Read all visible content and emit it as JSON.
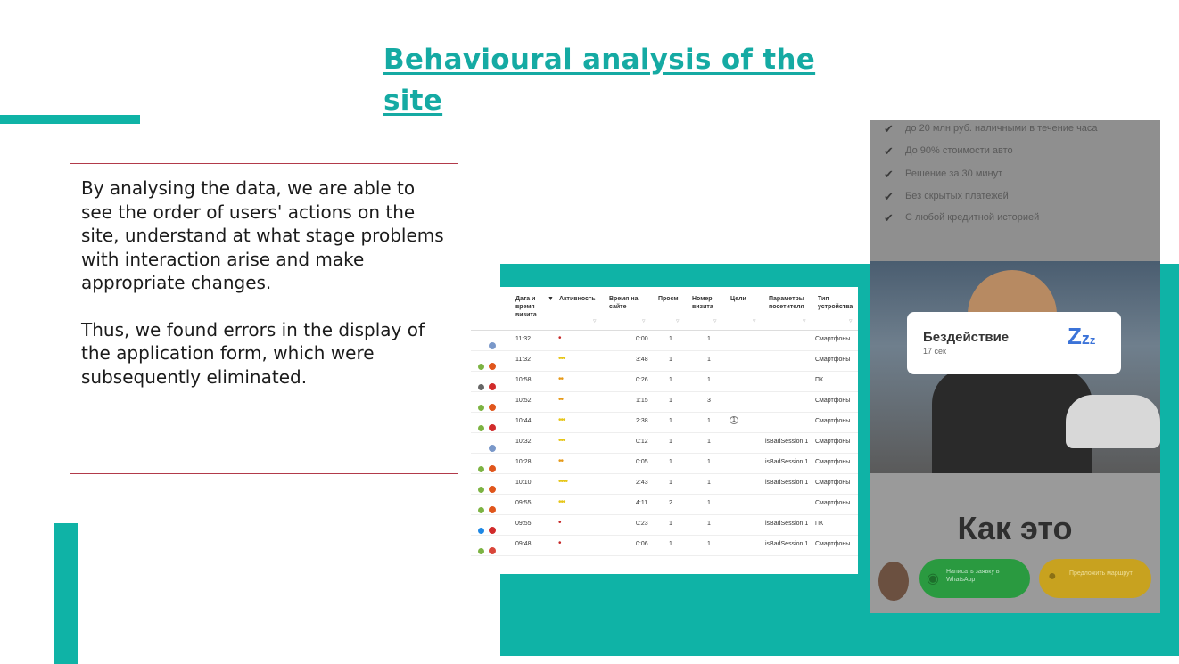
{
  "slide": {
    "title": "Behavioural analysis of the site",
    "paragraphs": [
      "By analysing the data, we are able to see the order of users' actions on the site, understand at what stage problems with interaction arise and make appropriate changes.",
      "Thus, we found errors in the display of the application form, which were subsequently eliminated."
    ],
    "accent_color": "#0fb3a6",
    "title_color": "#15aaa3",
    "box_border_color": "#b23a4a"
  },
  "visits_table": {
    "headers": [
      "Дата и время визита",
      "Активность",
      "Время на сайте",
      "Просм",
      "Номер визита",
      "Цели",
      "Параметры посетителя",
      "Тип устройства"
    ],
    "rows": [
      {
        "time": "11:32",
        "activity": "•",
        "duration": "0:00",
        "views": "1",
        "visit": "1",
        "goal": "",
        "params": "",
        "device": "Смартфоны"
      },
      {
        "time": "11:32",
        "activity": "•••",
        "duration": "3:48",
        "views": "1",
        "visit": "1",
        "goal": "",
        "params": "",
        "device": "Смартфоны"
      },
      {
        "time": "10:58",
        "activity": "••",
        "duration": "0:26",
        "views": "1",
        "visit": "1",
        "goal": "",
        "params": "",
        "device": "ПК"
      },
      {
        "time": "10:52",
        "activity": "••",
        "duration": "1:15",
        "views": "1",
        "visit": "3",
        "goal": "",
        "params": "",
        "device": "Смартфоны"
      },
      {
        "time": "10:44",
        "activity": "•••",
        "duration": "2:38",
        "views": "1",
        "visit": "1",
        "goal": "1",
        "params": "",
        "device": "Смартфоны"
      },
      {
        "time": "10:32",
        "activity": "•••",
        "duration": "0:12",
        "views": "1",
        "visit": "1",
        "goal": "",
        "params": "isBadSession.1",
        "device": "Смартфоны"
      },
      {
        "time": "10:28",
        "activity": "••",
        "duration": "0:05",
        "views": "1",
        "visit": "1",
        "goal": "",
        "params": "isBadSession.1",
        "device": "Смартфоны"
      },
      {
        "time": "10:10",
        "activity": "••••",
        "duration": "2:43",
        "views": "1",
        "visit": "1",
        "goal": "",
        "params": "isBadSession.1",
        "device": "Смартфоны"
      },
      {
        "time": "09:55",
        "activity": "•••",
        "duration": "4:11",
        "views": "2",
        "visit": "1",
        "goal": "",
        "params": "",
        "device": "Смартфоны"
      },
      {
        "time": "09:55",
        "activity": "•",
        "duration": "0:23",
        "views": "1",
        "visit": "1",
        "goal": "",
        "params": "isBadSession.1",
        "device": "ПК"
      },
      {
        "time": "09:48",
        "activity": "•",
        "duration": "0:06",
        "views": "1",
        "visit": "1",
        "goal": "",
        "params": "isBadSession.1",
        "device": "Смартфоны"
      }
    ]
  },
  "phone_screen": {
    "checklist": [
      "до 20 млн руб. наличными в течение часа",
      "До 90% стоимости авто",
      "Решение за 30 минут",
      "Без скрытых платежей",
      "С любой кредитной историей"
    ],
    "idle_label": "Бездействие",
    "idle_time": "17 сек",
    "idle_icon": "sleep-zzz-icon",
    "heading": "Как это",
    "buttons": [
      "Написать заявку в WhatsApp",
      "Предложить маршрут"
    ]
  }
}
